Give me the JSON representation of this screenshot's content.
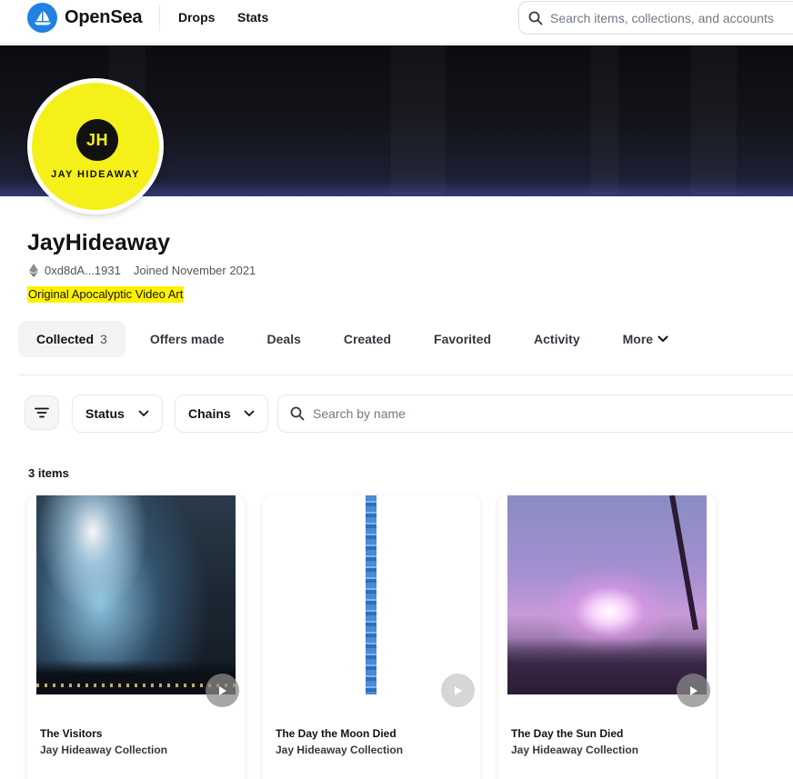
{
  "nav": {
    "brand": "OpenSea",
    "links": [
      "Drops",
      "Stats"
    ],
    "search_placeholder": "Search items, collections, and accounts"
  },
  "profile": {
    "avatar_initials": "JH",
    "avatar_label": "JAY HIDEAWAY",
    "name": "JayHideaway",
    "wallet": "0xd8dA...1931",
    "joined": "Joined November 2021",
    "bio": "Original Apocalyptic Video Art"
  },
  "tabs": {
    "collected_label": "Collected",
    "collected_count": "3",
    "offers_made": "Offers made",
    "deals": "Deals",
    "created": "Created",
    "favorited": "Favorited",
    "activity": "Activity",
    "more": "More"
  },
  "filters": {
    "status": "Status",
    "chains": "Chains",
    "search_placeholder": "Search by name"
  },
  "items_count": "3 items",
  "cards": [
    {
      "title": "The Visitors",
      "collection": "Jay Hideaway Collection"
    },
    {
      "title": "The Day the Moon Died",
      "collection": "Jay Hideaway Collection"
    },
    {
      "title": "The Day the Sun Died",
      "collection": "Jay Hideaway Collection"
    }
  ],
  "colors": {
    "brand_blue": "#2081e2",
    "avatar_yellow": "#f5f019",
    "bio_highlight": "#fff200"
  }
}
